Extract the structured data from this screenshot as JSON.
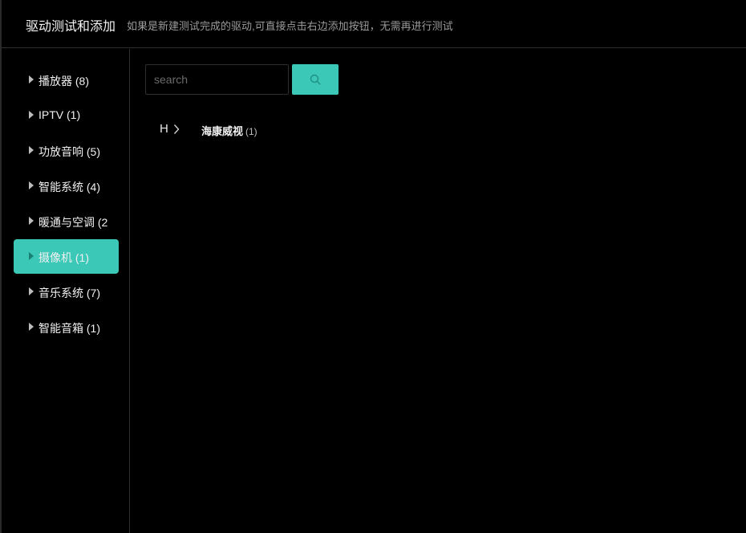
{
  "header": {
    "title": "驱动测试和添加",
    "hint": "如果是新建测试完成的驱动,可直接点击右边添加按钮，无需再进行测试"
  },
  "sidebar": {
    "items": [
      {
        "label": "播放器 (8)",
        "active": false
      },
      {
        "label": "IPTV (1)",
        "active": false
      },
      {
        "label": "功放音响 (5)",
        "active": false
      },
      {
        "label": "智能系统 (4)",
        "active": false
      },
      {
        "label": "暖通与空调 (2",
        "active": false
      },
      {
        "label": "摄像机 (1)",
        "active": true
      },
      {
        "label": "音乐系统 (7)",
        "active": false
      },
      {
        "label": "智能音箱 (1)",
        "active": false
      }
    ]
  },
  "search": {
    "placeholder": "search",
    "value": "",
    "button_icon": "search-icon"
  },
  "filter": {
    "letter": "H",
    "chevron_icon": "chevron-right-icon"
  },
  "brands": [
    {
      "name": "海康威视",
      "count": "(1)"
    }
  ],
  "colors": {
    "accent": "#3cc8b7",
    "background": "#000000",
    "border": "#2f2f2f"
  }
}
